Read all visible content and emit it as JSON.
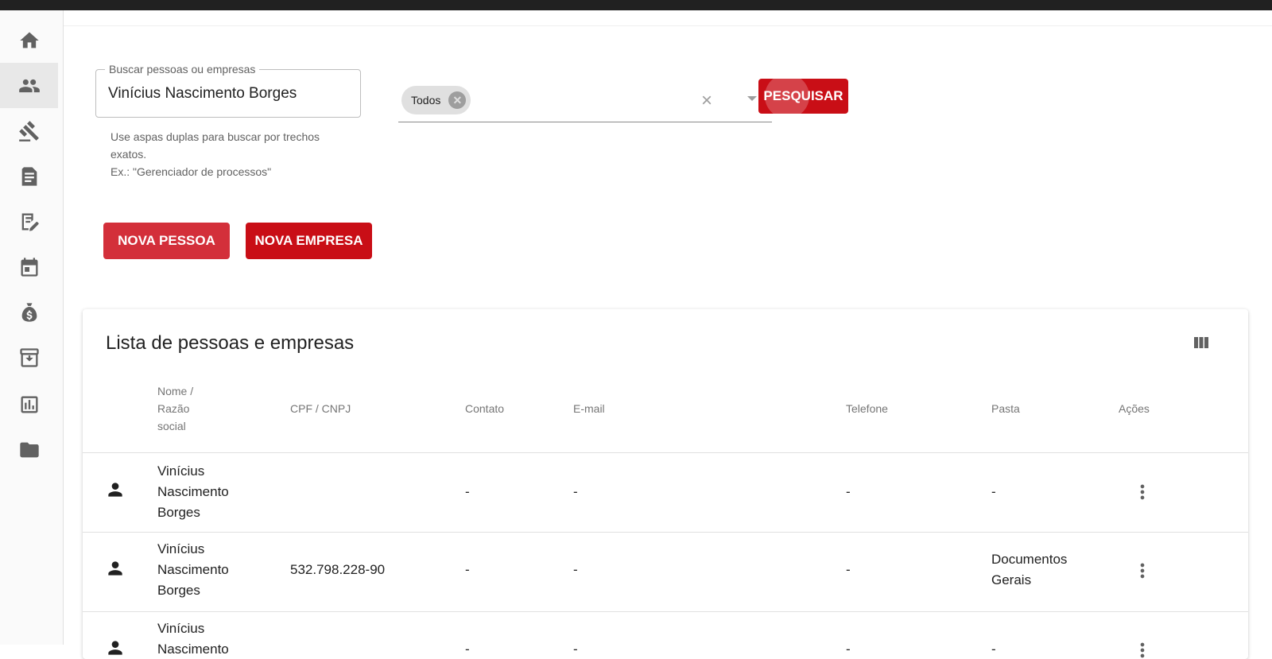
{
  "sidebar": {
    "items": [
      {
        "icon": "home-icon"
      },
      {
        "icon": "people-icon",
        "active": true
      },
      {
        "icon": "gavel-icon"
      },
      {
        "icon": "document-icon"
      },
      {
        "icon": "edit-document-icon"
      },
      {
        "icon": "calendar-icon"
      },
      {
        "icon": "money-bag-icon"
      },
      {
        "icon": "archive-icon"
      },
      {
        "icon": "chart-icon"
      },
      {
        "icon": "folder-icon"
      }
    ]
  },
  "search": {
    "label": "Buscar pessoas ou empresas",
    "value": "Vinícius Nascimento Borges",
    "helper_line1": "Use aspas duplas para buscar por trechos exatos.",
    "helper_line2": "Ex.: \"Gerenciador de processos\""
  },
  "filter": {
    "chip_label": "Todos",
    "clear_symbol": "×"
  },
  "buttons": {
    "search": "PESQUISAR",
    "new_person": "NOVA PESSOA",
    "new_company": "NOVA EMPRESA"
  },
  "list": {
    "title": "Lista de pessoas e empresas",
    "columns": {
      "name": "Nome / Razão social",
      "doc": "CPF / CNPJ",
      "contact": "Contato",
      "email": "E-mail",
      "phone": "Telefone",
      "folder": "Pasta",
      "actions": "Ações"
    },
    "rows": [
      {
        "type_icon": "person-icon",
        "name": "Vinícius Nascimento Borges",
        "doc": "",
        "contact": "-",
        "email": "-",
        "phone": "-",
        "folder": "-"
      },
      {
        "type_icon": "person-icon",
        "name": "Vinícius Nascimento Borges",
        "doc": "532.798.228-90",
        "contact": "-",
        "email": "-",
        "phone": "-",
        "folder": "Documentos Gerais"
      },
      {
        "type_icon": "person-icon",
        "name": "Vinícius Nascimento",
        "doc": "",
        "contact": "-",
        "email": "-",
        "phone": "-",
        "folder": "-"
      }
    ]
  },
  "colors": {
    "primary_red": "#c90e16",
    "secondary_red": "#d32f3a",
    "topbar": "#212121"
  }
}
